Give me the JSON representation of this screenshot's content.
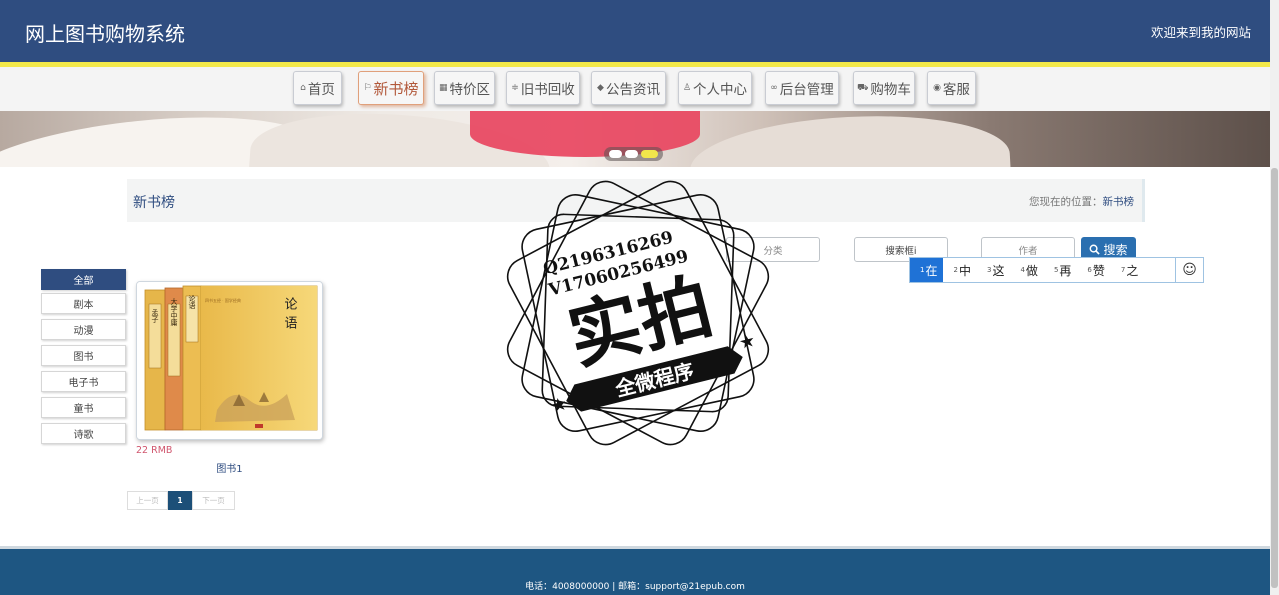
{
  "header": {
    "title": "网上图书购物系统",
    "welcome": "欢迎来到我的网站"
  },
  "nav": [
    {
      "label": "首页",
      "icon": "home-icon",
      "glyph": "⌂"
    },
    {
      "label": "新书榜",
      "icon": "flag-icon",
      "glyph": "⚐",
      "active": true
    },
    {
      "label": "特价区",
      "icon": "grid-icon",
      "glyph": "▦"
    },
    {
      "label": "旧书回收",
      "icon": "filter-icon",
      "glyph": "≑"
    },
    {
      "label": "公告资讯",
      "icon": "education-icon",
      "glyph": "◆"
    },
    {
      "label": "个人中心",
      "icon": "user-icon",
      "glyph": "♙"
    },
    {
      "label": "后台管理",
      "icon": "link-icon",
      "glyph": "∞"
    },
    {
      "label": "购物车",
      "icon": "cart-icon",
      "glyph": "⛟"
    },
    {
      "label": "客服",
      "icon": "support-icon",
      "glyph": "◉"
    }
  ],
  "page": {
    "title": "新书榜",
    "breadcrumb_prefix": "您现在的位置：",
    "breadcrumb_current": "新书榜"
  },
  "search": {
    "category_placeholder": "分类",
    "keyword_value": "搜索框i",
    "author_placeholder": "作者",
    "button_label": "搜索"
  },
  "ime": {
    "candidates": [
      {
        "n": "1",
        "char": "在",
        "active": true
      },
      {
        "n": "2",
        "char": "中"
      },
      {
        "n": "3",
        "char": "这"
      },
      {
        "n": "4",
        "char": "做"
      },
      {
        "n": "5",
        "char": "再"
      },
      {
        "n": "6",
        "char": "赞"
      },
      {
        "n": "7",
        "char": "之"
      }
    ],
    "emoji": "☺"
  },
  "categories": [
    {
      "label": "全部",
      "active": true
    },
    {
      "label": "剧本"
    },
    {
      "label": "动漫"
    },
    {
      "label": "图书"
    },
    {
      "label": "电子书"
    },
    {
      "label": "童书"
    },
    {
      "label": "诗歌"
    }
  ],
  "products": [
    {
      "name": "图书1",
      "price": "22 RMB",
      "cover": {
        "title": "论语",
        "spine_1": "孟子",
        "spine_2": "大学中庸",
        "spine_3": "论语"
      }
    }
  ],
  "pagination": {
    "prev": "上一页",
    "current": "1",
    "next": "下一页"
  },
  "footer": {
    "text": "电话：4008000000 | 邮箱：support@21epub.com"
  },
  "watermark": {
    "line1": "Q2196316269",
    "line2": "V17060256499",
    "main": "实拍",
    "ribbon": "全微程序"
  },
  "colors": {
    "header_bg": "#2f4d80",
    "accent_yellow": "#f3e94a",
    "footer_bg": "#1e5682",
    "search_button": "#2a6fb0",
    "price": "#d0556d"
  }
}
